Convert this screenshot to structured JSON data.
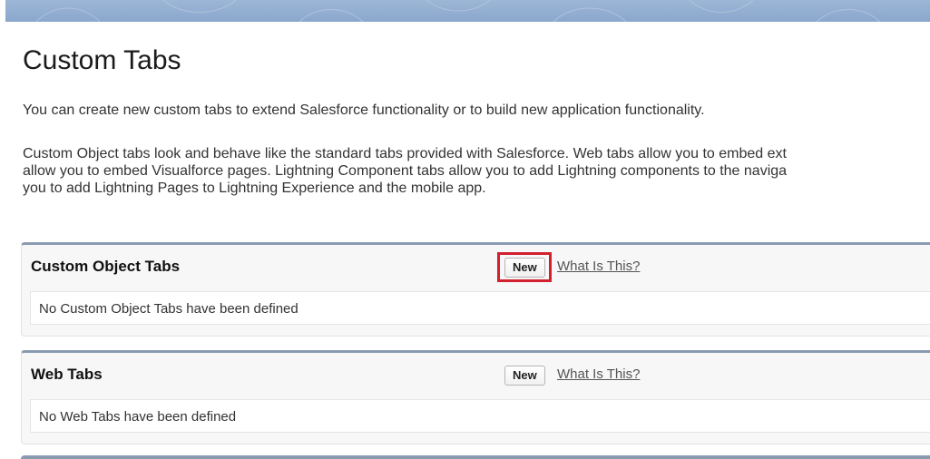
{
  "page": {
    "title": "Custom Tabs",
    "intro": "You can create new custom tabs to extend Salesforce functionality or to build new application functionality.",
    "description_lines": [
      "Custom Object tabs look and behave like the standard tabs provided with Salesforce. Web tabs allow you to embed ext",
      "allow you to embed Visualforce pages. Lightning Component tabs allow you to add Lightning components to the naviga",
      "you to add Lightning Pages to Lightning Experience and the mobile app."
    ]
  },
  "sections": [
    {
      "title": "Custom Object Tabs",
      "new_label": "New",
      "help_label": "What Is This?",
      "empty_message": "No Custom Object Tabs have been defined"
    },
    {
      "title": "Web Tabs",
      "new_label": "New",
      "help_label": "What Is This?",
      "empty_message": "No Web Tabs have been defined"
    }
  ],
  "colors": {
    "banner": "#9db6d6",
    "section_border": "#8a9bb1",
    "highlight": "#d2202f"
  }
}
